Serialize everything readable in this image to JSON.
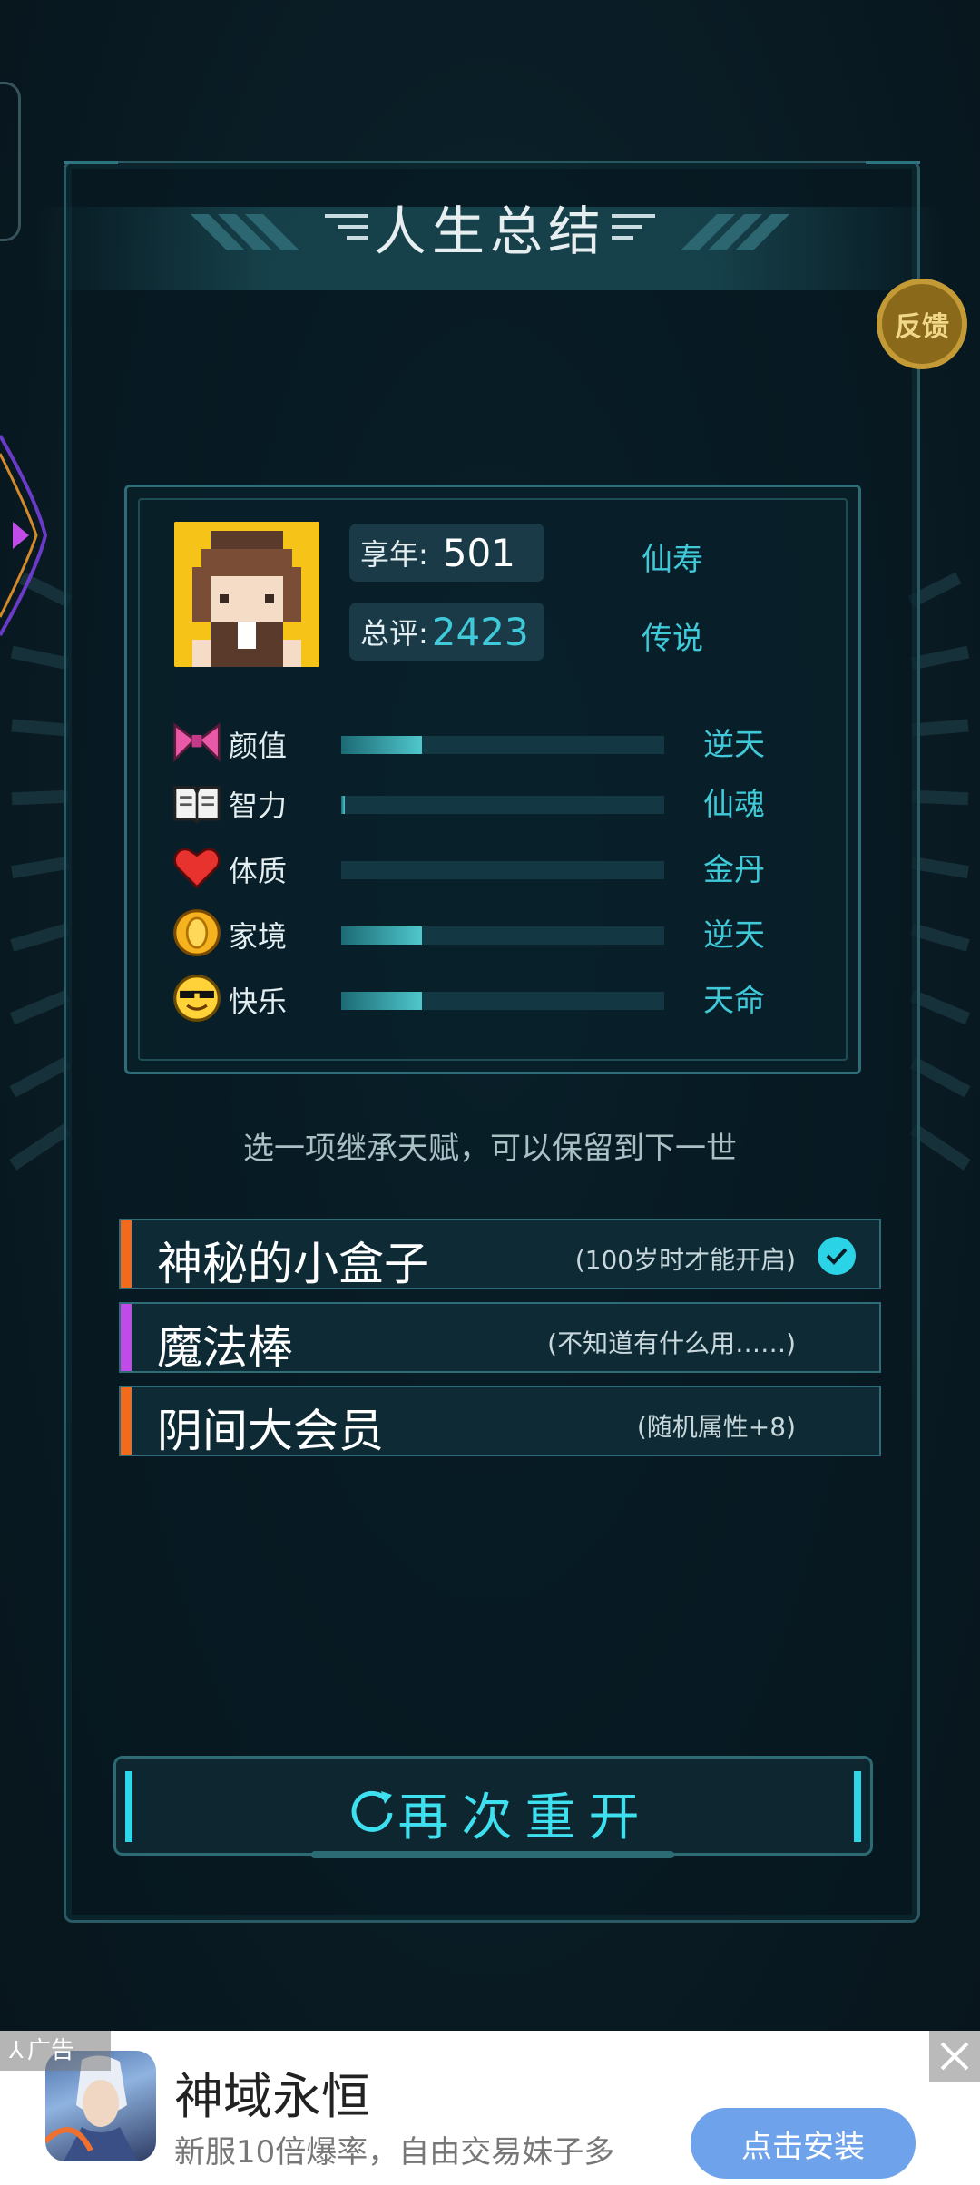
{
  "header": {
    "title": "人生总结"
  },
  "feedback": {
    "label": "反馈"
  },
  "summary": {
    "age_label": "享年:",
    "age_value": "501",
    "age_rank": "仙寿",
    "score_label": "总评:",
    "score_value": "2423",
    "score_rank": "传说",
    "accent_color": "#3fc9d9"
  },
  "attributes": [
    {
      "label": "颜值",
      "grade": "逆天",
      "icon": "bow-icon",
      "fill": 0.25
    },
    {
      "label": "智力",
      "grade": "仙魂",
      "icon": "book-icon",
      "fill": 0.01
    },
    {
      "label": "体质",
      "grade": "金丹",
      "icon": "heart-icon",
      "fill": 0.0
    },
    {
      "label": "家境",
      "grade": "逆天",
      "icon": "coin-icon",
      "fill": 0.25
    },
    {
      "label": "快乐",
      "grade": "天命",
      "icon": "cool-face-icon",
      "fill": 0.25
    }
  ],
  "inherit": {
    "tip": "选一项继承天赋，可以保留到下一世"
  },
  "talents": [
    {
      "name": "神秘的小盒子",
      "desc": "(100岁时才能开启)",
      "bar_color": "#f26a1b",
      "selected": true
    },
    {
      "name": "魔法棒",
      "desc": "(不知道有什么用……)",
      "bar_color": "#c04be8",
      "selected": false
    },
    {
      "name": "阴间大会员",
      "desc": "(随机属性+8)",
      "bar_color": "#f26a1b",
      "selected": false
    }
  ],
  "restart": {
    "label": "再次重开"
  },
  "ad": {
    "tag": "广告",
    "title": "神域永恒",
    "subtitle": "新服10倍爆率，自由交易妹子多",
    "button": "点击安装"
  }
}
